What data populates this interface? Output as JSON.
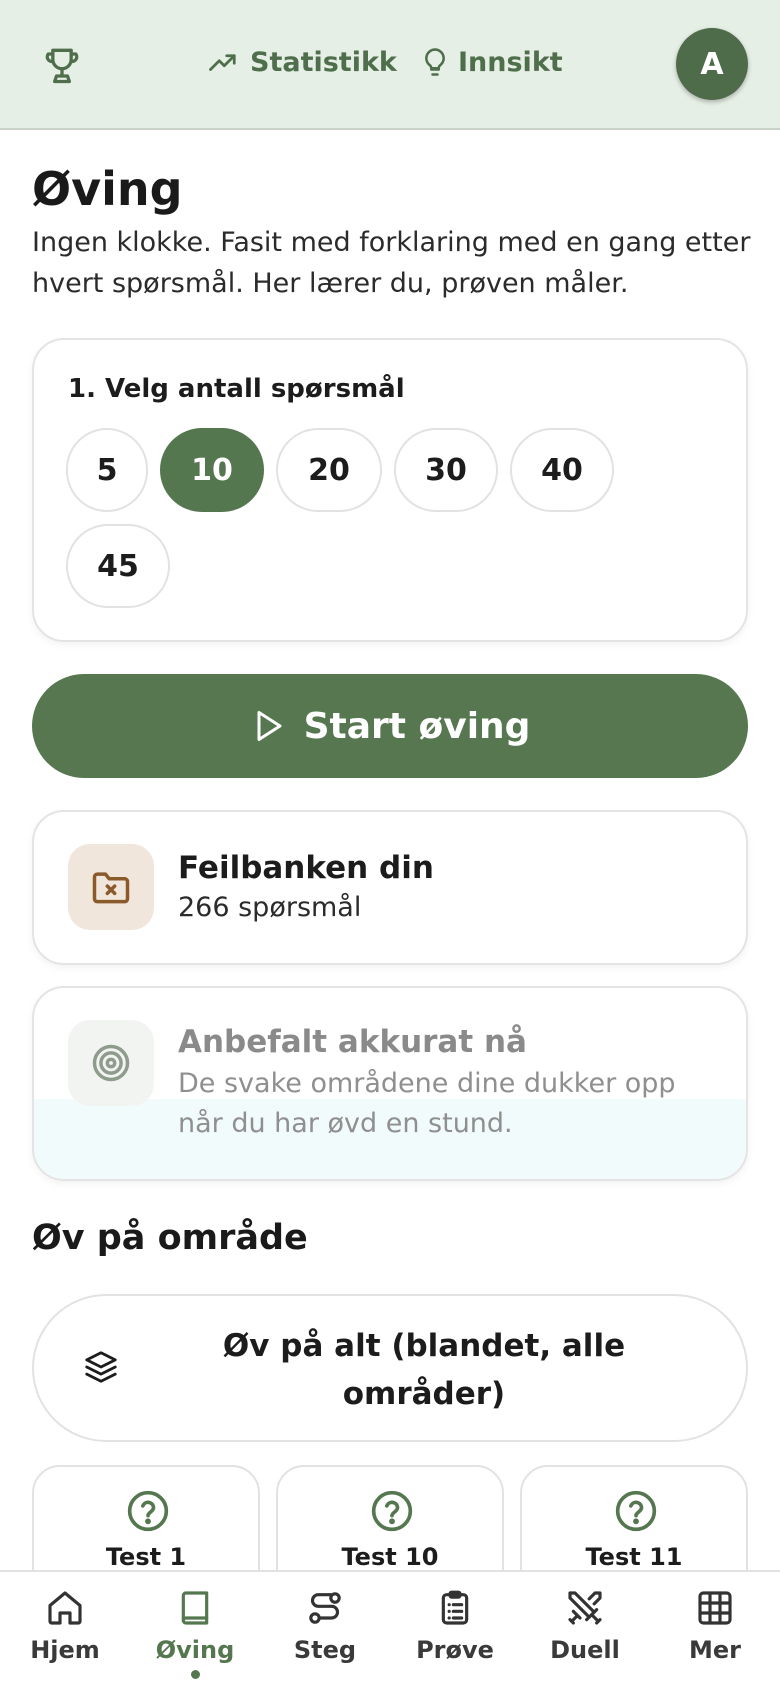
{
  "header": {
    "statistikk_label": "Statistikk",
    "innsikt_label": "Innsikt",
    "avatar_initial": "A"
  },
  "page": {
    "title": "Øving",
    "subtitle": "Ingen klokke. Fasit med forklaring med en gang etter hvert spørsmål. Her lærer du, prøven måler."
  },
  "question_count": {
    "label": "1. Velg antall spørsmål",
    "options": [
      "5",
      "10",
      "20",
      "30",
      "40",
      "45"
    ],
    "selected": "10"
  },
  "start_button": {
    "label": "Start øving"
  },
  "feilbank": {
    "title": "Feilbanken din",
    "count_text": "266 spørsmål"
  },
  "recommended": {
    "title": "Anbefalt akkurat nå",
    "text": "De svake områdene dine dukker opp når du har øvd en stund."
  },
  "areas": {
    "title": "Øv på område",
    "all_label": "Øv på alt (blandet, alle områder)",
    "topics": [
      {
        "label": "Test 1",
        "icon": "question-circle-icon"
      },
      {
        "label": "Test 10",
        "icon": "question-circle-icon"
      },
      {
        "label": "Test 11",
        "icon": "question-circle-icon"
      }
    ]
  },
  "nav": {
    "items": [
      {
        "label": "Hjem",
        "icon": "home-icon"
      },
      {
        "label": "Øving",
        "icon": "book-icon",
        "active": true
      },
      {
        "label": "Steg",
        "icon": "route-icon"
      },
      {
        "label": "Prøve",
        "icon": "clipboard-icon"
      },
      {
        "label": "Duell",
        "icon": "swords-icon"
      },
      {
        "label": "Mer",
        "icon": "grid-icon"
      }
    ]
  },
  "colors": {
    "accent": "#55774f",
    "header_bg": "#e5efe5",
    "feilbank_icon_bg": "#f1e6dc",
    "feilbank_icon": "#8b5a2b"
  }
}
